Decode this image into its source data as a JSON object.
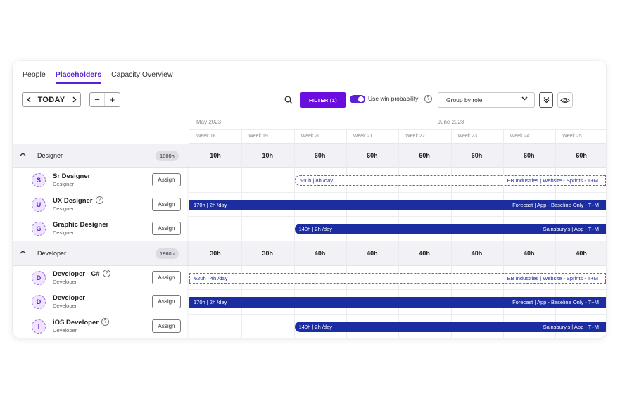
{
  "tabs": [
    {
      "label": "People",
      "active": false
    },
    {
      "label": "Placeholders",
      "active": true
    },
    {
      "label": "Capacity Overview",
      "active": false
    }
  ],
  "toolbar": {
    "prev_icon": "chevron-left-icon",
    "today_label": "TODAY",
    "next_icon": "chevron-right-icon",
    "zoom_out": "−",
    "zoom_in": "+",
    "filter_label": "FILTER (1)",
    "win_prob_label": "Use win probability",
    "win_prob_enabled": true,
    "group_by_value": "Group by role",
    "accent": "#6a0dde"
  },
  "timeline": {
    "months": [
      "May 2023",
      "June 2023"
    ],
    "weeks": [
      "Week 18",
      "Week 19",
      "Week 20",
      "Week 21",
      "Week 22",
      "Week 23",
      "Week 24",
      "Week 25"
    ]
  },
  "groups": [
    {
      "name": "Designer",
      "total": "1800h",
      "week_values": [
        "10h",
        "10h",
        "60h",
        "60h",
        "60h",
        "60h",
        "60h",
        "60h"
      ],
      "rows": [
        {
          "initial": "S",
          "name": "Sr Designer",
          "role": "Designer",
          "help": false,
          "assign": "Assign",
          "bar": {
            "style": "dashed",
            "left_text": "560h | 8h /day",
            "right_text": "EB Industries | Website - Sprints - T+M"
          }
        },
        {
          "initial": "U",
          "name": "UX Designer",
          "role": "Designer",
          "help": true,
          "assign": "Assign",
          "bar": {
            "style": "solid",
            "left_text": "170h | 2h /day",
            "right_text": "Forecast | App - Baseline Only - T+M"
          }
        },
        {
          "initial": "G",
          "name": "Graphic Designer",
          "role": "Designer",
          "help": false,
          "assign": "Assign",
          "bar": {
            "style": "solid-rounded",
            "left_text": "140h | 2h /day",
            "right_text": "Sainsbury's | App - T+M"
          }
        }
      ]
    },
    {
      "name": "Developer",
      "total": "1860h",
      "week_values": [
        "30h",
        "30h",
        "40h",
        "40h",
        "40h",
        "40h",
        "40h",
        "40h"
      ],
      "rows": [
        {
          "initial": "D",
          "name": "Developer - C#",
          "role": "Developer",
          "help": true,
          "assign": "Assign",
          "bar": {
            "style": "dashed",
            "left_text": "620h | 4h /day",
            "right_text": "EB Industries | Website - Sprints - T+M"
          }
        },
        {
          "initial": "D",
          "name": "Developer",
          "role": "Developer",
          "help": false,
          "assign": "Assign",
          "bar": {
            "style": "solid",
            "left_text": "170h | 2h /day",
            "right_text": "Forecast | App - Baseline Only - T+M"
          }
        },
        {
          "initial": "I",
          "name": "iOS Developer",
          "role": "Developer",
          "help": true,
          "assign": "Assign",
          "bar": {
            "style": "solid-rounded",
            "left_text": "140h | 2h /day",
            "right_text": "Sainsbury's | App - T+M"
          }
        }
      ]
    }
  ]
}
